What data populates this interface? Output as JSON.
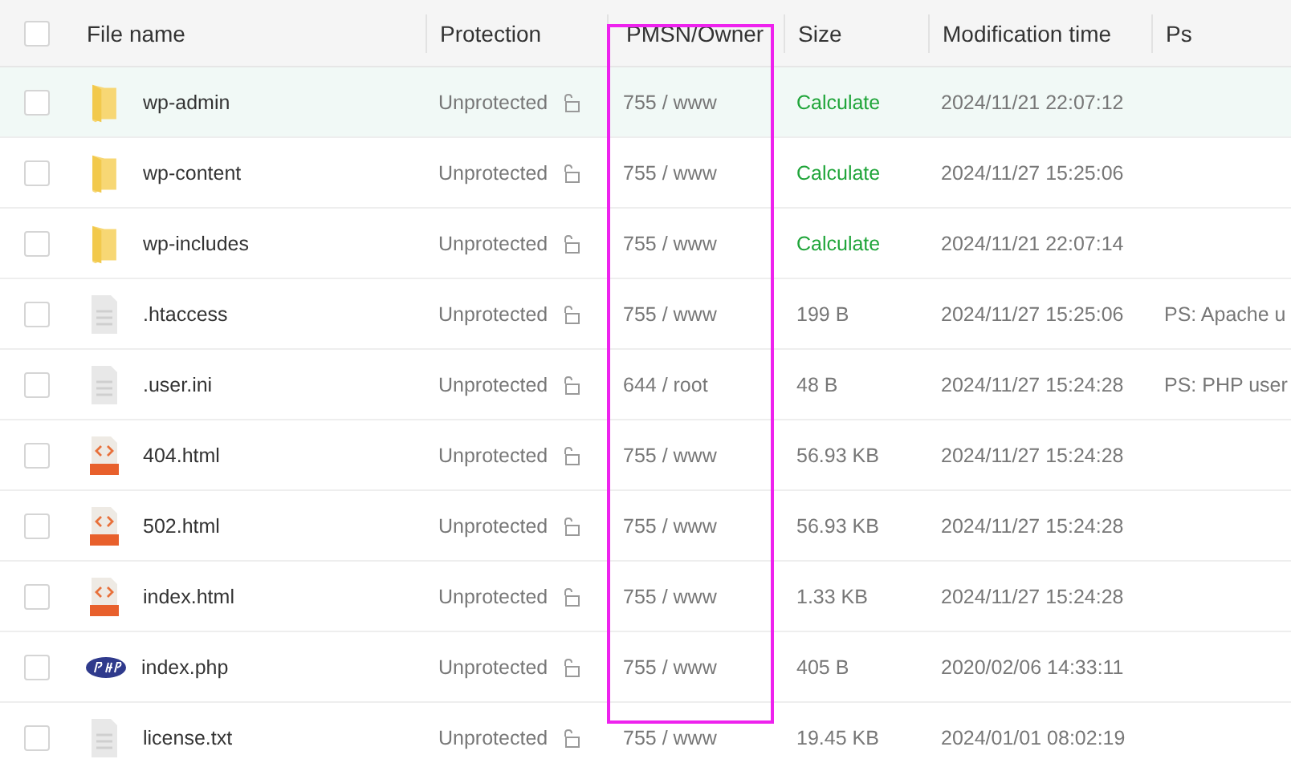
{
  "table": {
    "select_all": {
      "checked": false
    },
    "columns": [
      "File name",
      "Protection",
      "PMSN/Owner",
      "Size",
      "Modification time",
      "Ps"
    ],
    "rows": [
      {
        "kind": "folder",
        "name": "wp-admin",
        "protection": "Unprotected",
        "perm": "755 / www",
        "size": "Calculate",
        "time": "2024/11/21 22:07:12",
        "checked": false,
        "selected": true
      },
      {
        "kind": "folder",
        "name": "wp-content",
        "protection": "Unprotected",
        "perm": "755 / www",
        "size": "Calculate",
        "time": "2024/11/27 15:25:06",
        "checked": false,
        "selected": false
      },
      {
        "kind": "folder",
        "name": "wp-includes",
        "protection": "Unprotected",
        "perm": "755 / www",
        "size": "Calculate",
        "time": "2024/11/21 22:07:14",
        "checked": false,
        "selected": false
      },
      {
        "kind": "text",
        "name": ".htaccess",
        "protection": "Unprotected",
        "perm": "755 / www",
        "size": "199 B",
        "time": "2024/11/27 15:25:06",
        "ps": "PS: Apache u",
        "checked": false,
        "selected": false
      },
      {
        "kind": "text",
        "name": ".user.ini",
        "protection": "Unprotected",
        "perm": "644 / root",
        "size": "48 B",
        "time": "2024/11/27 15:24:28",
        "ps": "PS: PHP user",
        "checked": false,
        "selected": false
      },
      {
        "kind": "html",
        "name": "404.html",
        "protection": "Unprotected",
        "perm": "755 / www",
        "size": "56.93 KB",
        "time": "2024/11/27 15:24:28",
        "checked": false,
        "selected": false
      },
      {
        "kind": "html",
        "name": "502.html",
        "protection": "Unprotected",
        "perm": "755 / www",
        "size": "56.93 KB",
        "time": "2024/11/27 15:24:28",
        "checked": false,
        "selected": false
      },
      {
        "kind": "html",
        "name": "index.html",
        "protection": "Unprotected",
        "perm": "755 / www",
        "size": "1.33 KB",
        "time": "2024/11/27 15:24:28",
        "checked": false,
        "selected": false
      },
      {
        "kind": "php",
        "name": "index.php",
        "protection": "Unprotected",
        "perm": "755 / www",
        "size": "405 B",
        "time": "2020/02/06 14:33:11",
        "checked": false,
        "selected": false
      },
      {
        "kind": "text",
        "name": "license.txt",
        "protection": "Unprotected",
        "perm": "755 / www",
        "size": "19.45 KB",
        "time": "2024/01/01 08:02:19",
        "checked": false,
        "selected": false
      }
    ]
  }
}
